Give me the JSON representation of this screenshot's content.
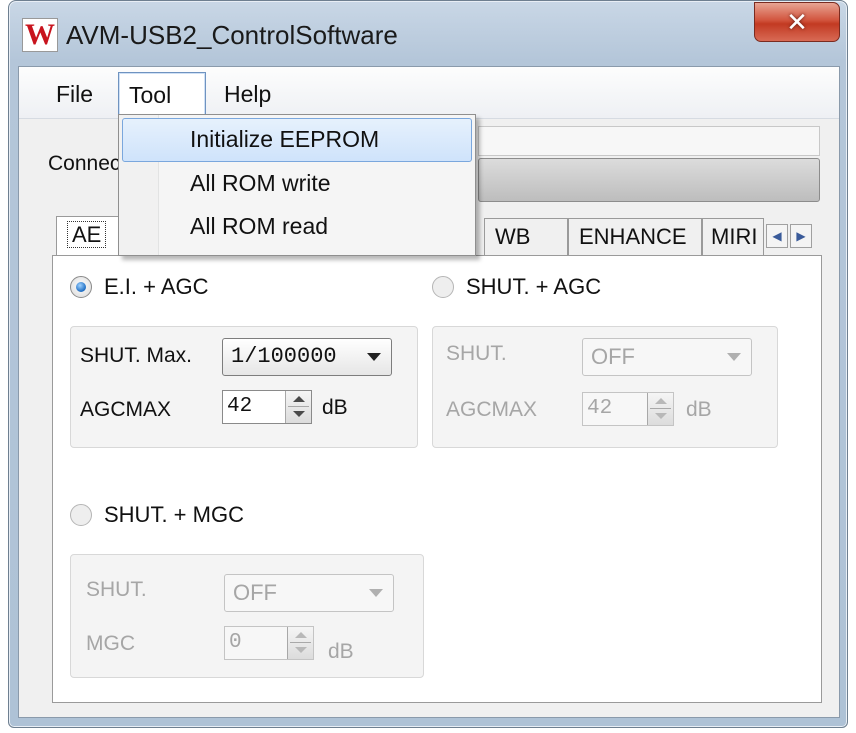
{
  "window": {
    "title": "AVM-USB2_ControlSoftware",
    "logo_letter": "W",
    "close_symbol": "✕",
    "accent_color": "#c8141e"
  },
  "menubar": {
    "items": [
      {
        "label": "File"
      },
      {
        "label": "Tool"
      },
      {
        "label": "Help"
      }
    ]
  },
  "tool_menu": {
    "items": [
      {
        "label": "Initialize EEPROM",
        "highlighted": true
      },
      {
        "label": "All ROM write"
      },
      {
        "label": "All ROM read"
      }
    ]
  },
  "connect": {
    "label_visible": "Connec"
  },
  "tabs": {
    "items": [
      {
        "label": "AE",
        "selected": true
      },
      {
        "label": "WB"
      },
      {
        "label": "ENHANCE"
      },
      {
        "label": "MIRI"
      }
    ],
    "scroll_left": "◀",
    "scroll_right": "▶"
  },
  "ae": {
    "ei_agc": {
      "label": "E.I. + AGC",
      "selected": true,
      "shut_max_label": "SHUT. Max.",
      "shut_max_value": "1/100000",
      "agcmax_label": "AGCMAX",
      "agcmax_value": "42",
      "unit": "dB"
    },
    "shut_agc": {
      "label": "SHUT. + AGC",
      "selected": false,
      "shut_label": "SHUT.",
      "shut_value": "OFF",
      "agcmax_label": "AGCMAX",
      "agcmax_value": "42",
      "unit": "dB"
    },
    "shut_mgc": {
      "label": "SHUT. + MGC",
      "selected": false,
      "shut_label": "SHUT.",
      "shut_value": "OFF",
      "mgc_label": "MGC",
      "mgc_value": "0",
      "unit": "dB"
    }
  }
}
